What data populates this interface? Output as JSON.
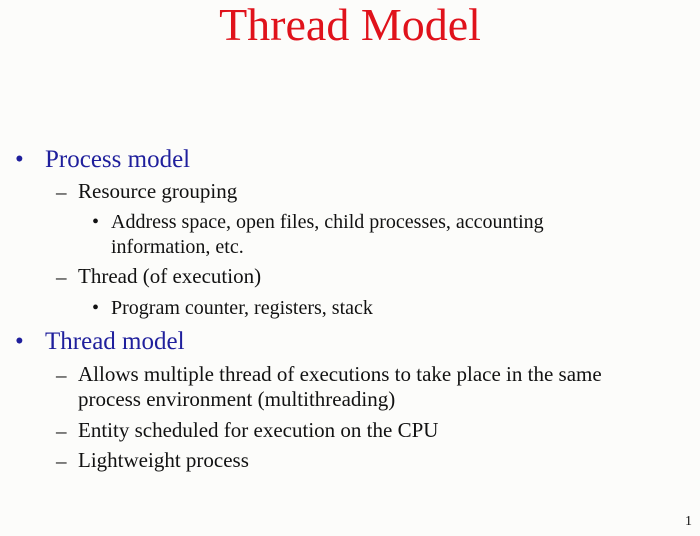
{
  "slide": {
    "title": "Thread Model",
    "page_number": "1",
    "bullets": {
      "level1": "•",
      "level2": "–",
      "level3": "•"
    },
    "items": [
      {
        "text": "Process model"
      },
      {
        "text": "Resource grouping"
      },
      {
        "text": "Address space, open files, child processes, accounting"
      },
      {
        "text": "information, etc."
      },
      {
        "text": "Thread (of execution)"
      },
      {
        "text": "Program counter, registers, stack"
      },
      {
        "text": "Thread model"
      },
      {
        "text": "Allows multiple thread of executions to take place in the same"
      },
      {
        "text": "process environment (multithreading)"
      },
      {
        "text": "Entity scheduled for execution on the CPU"
      },
      {
        "text": "Lightweight process"
      }
    ]
  },
  "colors": {
    "title": "#e0121b",
    "level1_text": "#1f1f9c",
    "body_text": "#111111",
    "background": "#fcfcfa"
  }
}
